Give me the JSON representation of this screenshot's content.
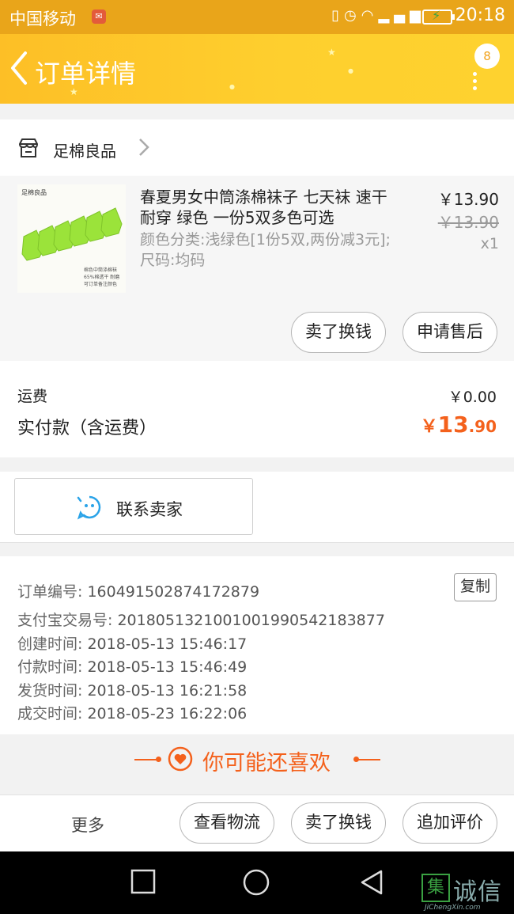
{
  "status_bar": {
    "carrier": "中国移动",
    "time": "20:18",
    "icons": [
      "mail-icon",
      "vibrate-icon",
      "alarm-icon",
      "wifi-icon",
      "signal-icon",
      "battery-charging-icon"
    ],
    "network": "G"
  },
  "header": {
    "title": "订单详情",
    "badge_count": "8"
  },
  "shop": {
    "name": "足棉良品"
  },
  "product": {
    "title": "春夏男女中筒涤棉袜子 七天袜 速干 耐穿 绿色 一份5双多色可选",
    "spec": "颜色分类:浅绿色[1份5双,两份减3元];尺码:均码",
    "price": "￥13.90",
    "original_price": "￥13.90",
    "quantity": "x1",
    "thumb_label": "足棉良品",
    "thumb_note": "棉色中筒涤棉袜 65%棉透干 耐磨 可订单备注颜色",
    "actions": [
      "卖了换钱",
      "申请售后"
    ]
  },
  "totals": {
    "shipping_label": "运费",
    "shipping_value": "￥0.00",
    "paid_label": "实付款（含运费）",
    "paid_currency": "￥",
    "paid_int": "13",
    "paid_dec": ".90"
  },
  "contact": {
    "label": "联系卖家"
  },
  "order_info": {
    "copy_label": "复制",
    "rows": [
      {
        "key": "订单编号:",
        "value": "160491502874172879"
      },
      {
        "key": "支付宝交易号:",
        "value": "2018051321001001990542183877"
      },
      {
        "key": "创建时间:",
        "value": "2018-05-13 15:46:17"
      },
      {
        "key": "付款时间:",
        "value": "2018-05-13 15:46:49"
      },
      {
        "key": "发货时间:",
        "value": "2018-05-13 16:21:58"
      },
      {
        "key": "成交时间:",
        "value": "2018-05-23 16:22:06"
      }
    ]
  },
  "guess": {
    "text": "你可能还喜欢"
  },
  "bottom_bar": {
    "more": "更多",
    "buttons": [
      "查看物流",
      "卖了换钱",
      "追加评价"
    ]
  },
  "watermark": {
    "box_char": "集",
    "big": "诚信",
    "small": "JiChengXin.com"
  },
  "colors": {
    "accent_orange": "#f4611c",
    "header_yellow": "#fecf2e",
    "status_yellow": "#e9a51a",
    "contact_blue": "#2aa3e8"
  }
}
